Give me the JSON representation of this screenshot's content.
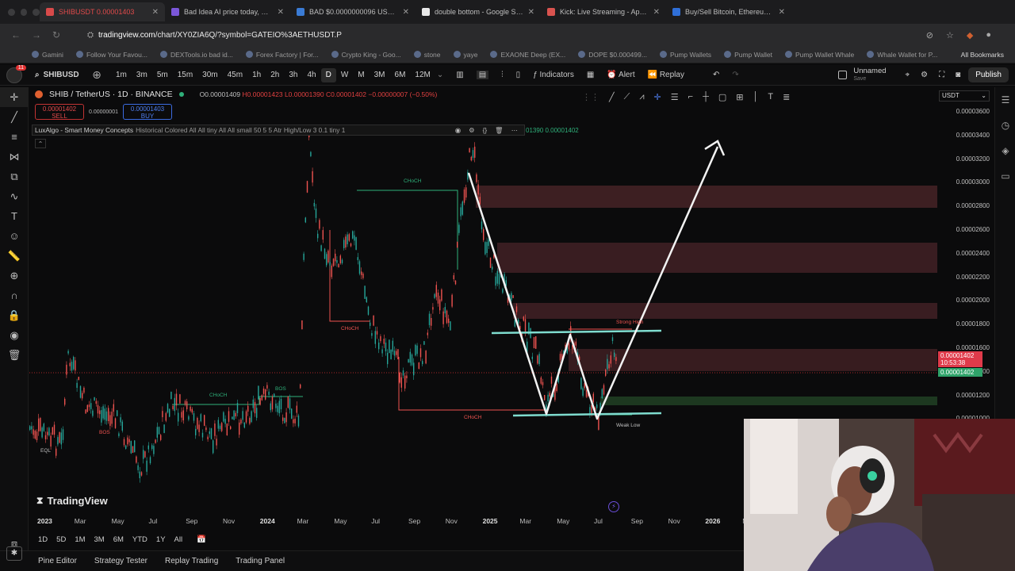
{
  "tabs": [
    {
      "title": "SHIBUSDT 0.00001403",
      "color": "#d84a4a",
      "active": true
    },
    {
      "title": "Bad Idea AI price today, BAD",
      "color": "#7b57d9",
      "active": false
    },
    {
      "title": "BAD $0.0000000096 USD p",
      "color": "#3a7bd5",
      "active": false
    },
    {
      "title": "double bottom - Google Sea",
      "color": "#e8e8e8",
      "active": false
    },
    {
      "title": "Kick: Live Streaming - Apps o",
      "color": "#d9534f",
      "active": false
    },
    {
      "title": "Buy/Sell Bitcoin, Ethereum ar",
      "color": "#2f6fd8",
      "active": false
    }
  ],
  "address": {
    "host": "tradingview.com",
    "path": "/chart/XY0ZIA6Q/?symbol=GATEIO%3AETHUSDT.P"
  },
  "bookmarks": [
    "Gamini",
    "Follow Your Favou...",
    "DEXTools.io bad id...",
    "Forex Factory | For...",
    "Crypto King - Goo...",
    "stone",
    "yaye",
    "EXAONE Deep (EX...",
    "DOPE $0.000499...",
    "Pump Wallets",
    "Pump Wallet",
    "Pump Wallet Whale",
    "Whale Wallet for P..."
  ],
  "all_bookmarks": "All Bookmarks",
  "toolbar": {
    "symbol": "SHIBUSD",
    "timeframes": [
      "1m",
      "3m",
      "5m",
      "15m",
      "30m",
      "45m",
      "1h",
      "2h",
      "3h",
      "4h",
      "D",
      "W",
      "M",
      "3M",
      "6M",
      "12M"
    ],
    "selected_timeframe": "D",
    "indicators": "Indicators",
    "alert": "Alert",
    "replay": "Replay",
    "layout_name": "Unnamed",
    "layout_sub": "Save",
    "publish": "Publish"
  },
  "header": {
    "symbol_line": "SHIB / TetherUS · 1D · BINANCE",
    "o": "O0.00001409",
    "h": "H0.00001423",
    "l": "L0.00001390",
    "c": "C0.00001402",
    "chg": "−0.00000007 (−0.50%)",
    "sell_price": "0.00001402",
    "sell_label": "SELL",
    "spread": "0.00000001",
    "buy_price": "0.00001403",
    "buy_label": "BUY"
  },
  "indicator": {
    "name": "LuxAlgo - Smart Money Concepts",
    "params": "Historical Colored All All tiny All All small 50 5 5 Atr High/Low 3 0.1 tiny 1",
    "values": "01390  0.00001402"
  },
  "price_axis": {
    "currency": "USDT",
    "levels": [
      "0.00003600",
      "0.00003400",
      "0.00003200",
      "0.00003000",
      "0.00002800",
      "0.00002600",
      "0.00002400",
      "0.00002200",
      "0.00002000",
      "0.00001800",
      "0.00001600",
      "0.00001400",
      "0.00001200",
      "0.00001000"
    ],
    "current_price": "0.00001402",
    "countdown": "10:53:38",
    "bid_price": "0.00001402"
  },
  "time_axis": {
    "labels": [
      "2023",
      "Mar",
      "May",
      "Jul",
      "Sep",
      "Nov",
      "2024",
      "Mar",
      "May",
      "Jul",
      "Sep",
      "Nov",
      "2025",
      "Mar",
      "May",
      "Jul",
      "Sep",
      "Nov",
      "2026",
      "M"
    ],
    "year_labels": [
      "2023",
      "2024",
      "2025",
      "2026"
    ]
  },
  "ranges": [
    "1D",
    "5D",
    "1M",
    "3M",
    "6M",
    "YTD",
    "1Y",
    "All"
  ],
  "bottom_tabs": [
    "Pine Editor",
    "Strategy Tester",
    "Replay Trading",
    "Trading Panel"
  ],
  "brand": "TradingView",
  "chart_labels": {
    "choch": "CHoCH",
    "bos": "BOS",
    "eql": "EQL",
    "weak_low": "Weak Low",
    "strong_high": "Strong High"
  },
  "colors": {
    "bull": "#26a69a",
    "bear": "#ef5350",
    "accent_red": "#e03030",
    "zone": "#5a2a2e",
    "green_zone": "#1f3d22"
  }
}
